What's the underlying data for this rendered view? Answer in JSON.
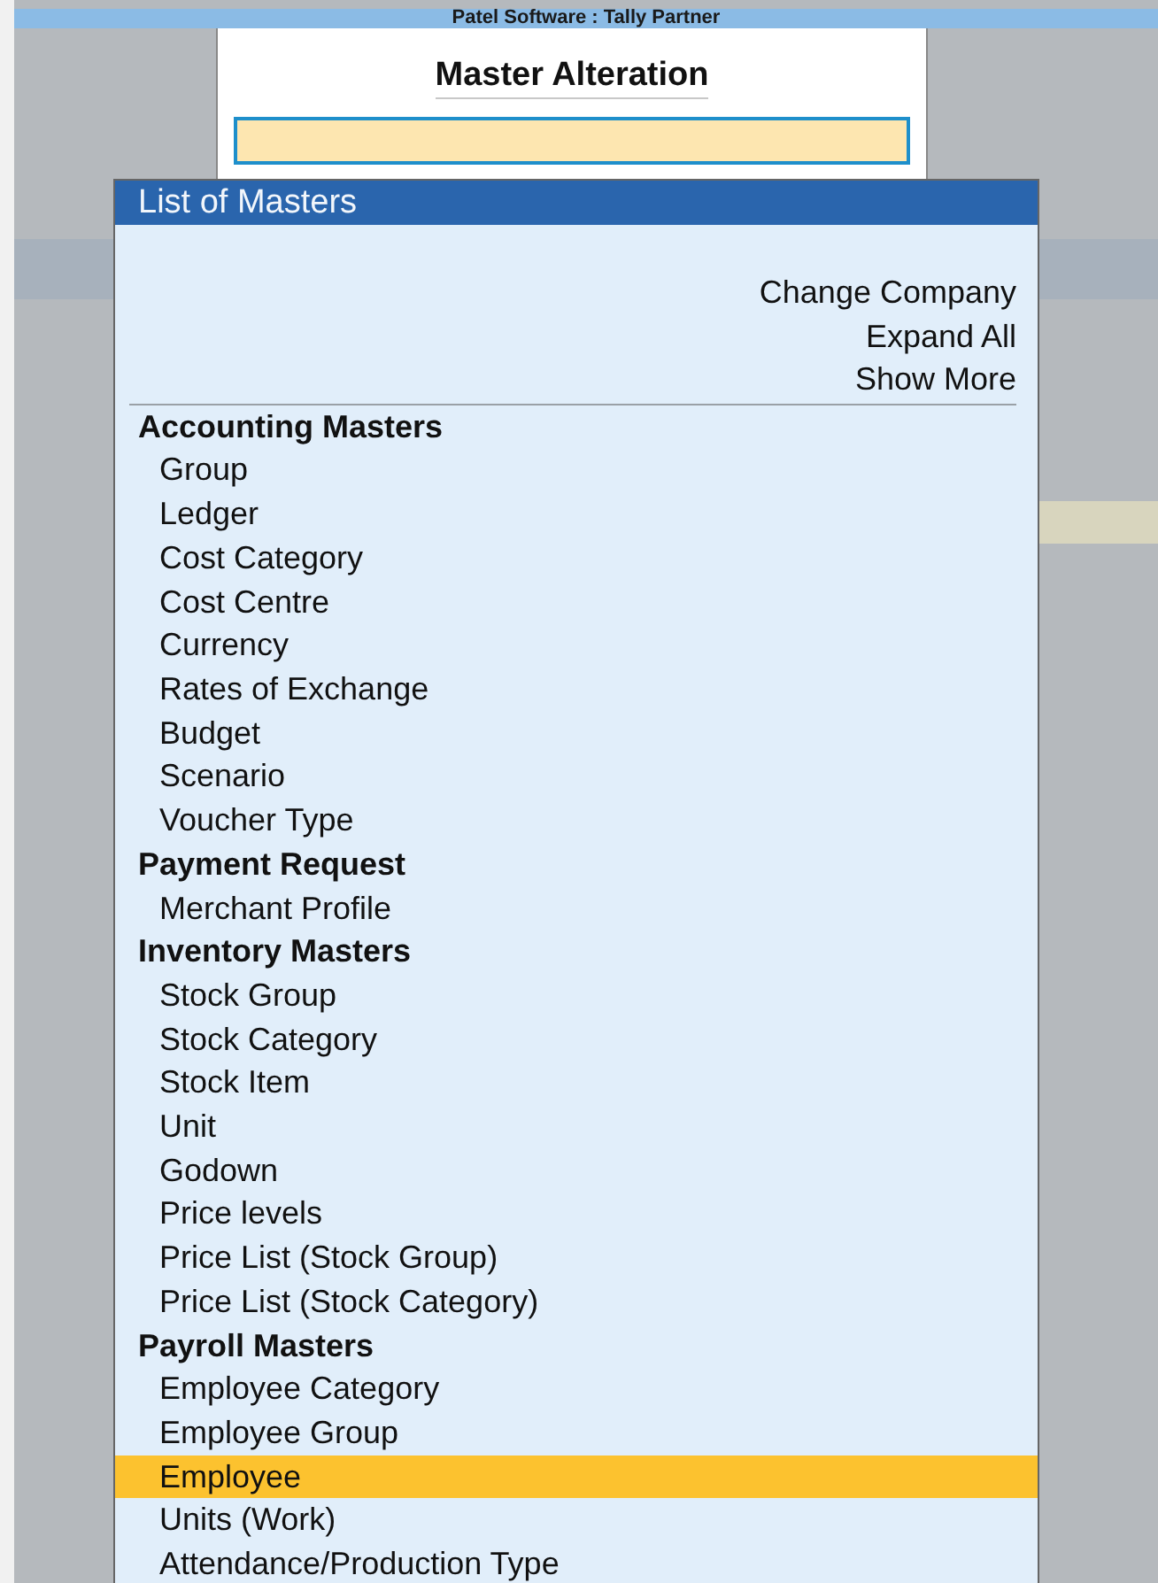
{
  "app_title": "Patel Software : Tally Partner",
  "screen": {
    "title": "Master Alteration"
  },
  "list": {
    "title": "List of Masters",
    "actions": [
      "Change Company",
      "Expand All",
      "Show More"
    ],
    "groups": [
      {
        "title": "Accounting Masters",
        "items": [
          {
            "label": "Group",
            "selected": false
          },
          {
            "label": "Ledger",
            "selected": false
          },
          {
            "label": "Cost Category",
            "selected": false
          },
          {
            "label": "Cost Centre",
            "selected": false
          },
          {
            "label": "Currency",
            "selected": false
          },
          {
            "label": "Rates of Exchange",
            "selected": false
          },
          {
            "label": "Budget",
            "selected": false
          },
          {
            "label": "Scenario",
            "selected": false
          },
          {
            "label": "Voucher Type",
            "selected": false
          }
        ]
      },
      {
        "title": "Payment Request",
        "items": [
          {
            "label": "Merchant Profile",
            "selected": false
          }
        ]
      },
      {
        "title": "Inventory Masters",
        "items": [
          {
            "label": "Stock Group",
            "selected": false
          },
          {
            "label": "Stock Category",
            "selected": false
          },
          {
            "label": "Stock Item",
            "selected": false
          },
          {
            "label": "Unit",
            "selected": false
          },
          {
            "label": "Godown",
            "selected": false
          },
          {
            "label": "Price levels",
            "selected": false
          },
          {
            "label": "Price List (Stock Group)",
            "selected": false
          },
          {
            "label": "Price List (Stock Category)",
            "selected": false
          }
        ]
      },
      {
        "title": "Payroll Masters",
        "items": [
          {
            "label": "Employee Category",
            "selected": false
          },
          {
            "label": "Employee Group",
            "selected": false
          },
          {
            "label": "Employee",
            "selected": true
          },
          {
            "label": "Units (Work)",
            "selected": false
          },
          {
            "label": "Attendance/Production Type",
            "selected": false
          }
        ]
      }
    ]
  }
}
